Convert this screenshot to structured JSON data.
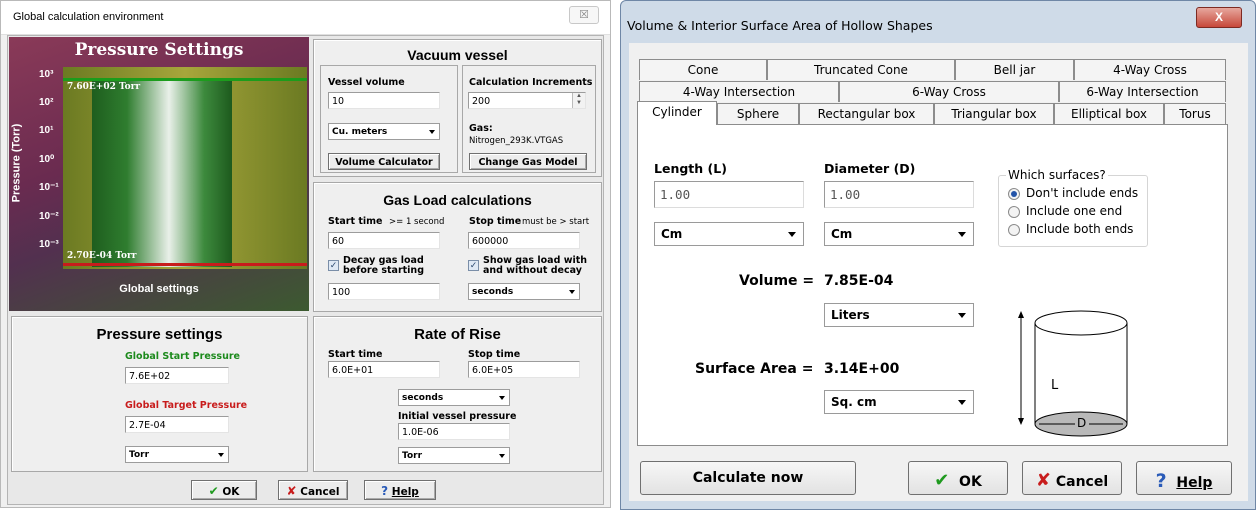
{
  "left_dialog": {
    "title": "Global calculation environment",
    "close_glyph": "☒",
    "gauge": {
      "title": "Pressure Settings",
      "y_axis_label": "Pressure (Torr)",
      "ticks": [
        "10³",
        "10²",
        "10¹",
        "10⁰",
        "10⁻¹",
        "10⁻²",
        "10⁻³"
      ],
      "start_pressure_text": "7.60E+02 Torr",
      "target_pressure_text": "2.70E-04 Torr",
      "footer": "Global settings"
    },
    "vacuum_vessel": {
      "heading": "Vacuum vessel",
      "volume_label": "Vessel volume",
      "volume_value": "10",
      "increments_label": "Calculation Increments",
      "increments_value": "200",
      "units_value": "Cu. meters",
      "gas_label": "Gas:",
      "gas_value": "Nitrogen_293K.VTGAS",
      "volume_calc_button": "Volume Calculator",
      "change_gas_button": "Change Gas Model"
    },
    "pressure_settings": {
      "heading": "Pressure settings",
      "start_label": "Global Start Pressure",
      "start_value": "7.6E+02",
      "target_label": "Global Target Pressure",
      "target_value": "2.7E-04",
      "units_value": "Torr"
    },
    "gas_load": {
      "heading": "Gas Load calculations",
      "start_label": "Start time",
      "start_hint": ">= 1 second",
      "start_value": "60",
      "stop_label": "Stop time",
      "stop_hint": "must be > start",
      "stop_value": "600000",
      "decay_label_1": "Decay gas load",
      "decay_label_2": "before starting",
      "decay_checked": true,
      "decay_value": "100",
      "show_label_1": "Show gas load with",
      "show_label_2": "and without decay",
      "show_checked": true,
      "units_value": "seconds"
    },
    "rate_of_rise": {
      "heading": "Rate of Rise",
      "start_label": "Start time",
      "start_value": "6.0E+01",
      "stop_label": "Stop time",
      "stop_value": "6.0E+05",
      "time_units_value": "seconds",
      "initial_pressure_label": "Initial vessel pressure",
      "initial_pressure_value": "1.0E-06",
      "pressure_units_value": "Torr"
    },
    "buttons": {
      "ok": "OK",
      "cancel": "Cancel",
      "help": "Help"
    }
  },
  "right_dialog": {
    "title": "Volume & Interior Surface Area of Hollow Shapes",
    "close_glyph": "X",
    "tabs_row1": [
      "Cone",
      "Truncated Cone",
      "Bell jar",
      "4-Way Cross"
    ],
    "tabs_row2": [
      "4-Way Intersection",
      "6-Way Cross",
      "6-Way Intersection"
    ],
    "tabs_row3": [
      "Cylinder",
      "Sphere",
      "Rectangular box",
      "Triangular box",
      "Elliptical box",
      "Torus"
    ],
    "length_label": "Length (L)",
    "length_value": "1.00",
    "length_units": "Cm",
    "diameter_label": "Diameter (D)",
    "diameter_value": "1.00",
    "diameter_units": "Cm",
    "surfaces_title": "Which surfaces?",
    "surface_options": [
      "Don't include ends",
      "Include one end",
      "Include both ends"
    ],
    "surface_selected_index": 0,
    "volume_label": "Volume =",
    "volume_value": "7.85E-04",
    "volume_units": "Liters",
    "area_label": "Surface Area =",
    "area_value": "3.14E+00",
    "area_units": "Sq. cm",
    "diagram_length_letter": "L",
    "diagram_diameter_letter": "D",
    "buttons": {
      "calculate": "Calculate now",
      "ok": "OK",
      "cancel": "Cancel",
      "help": "Help"
    }
  }
}
